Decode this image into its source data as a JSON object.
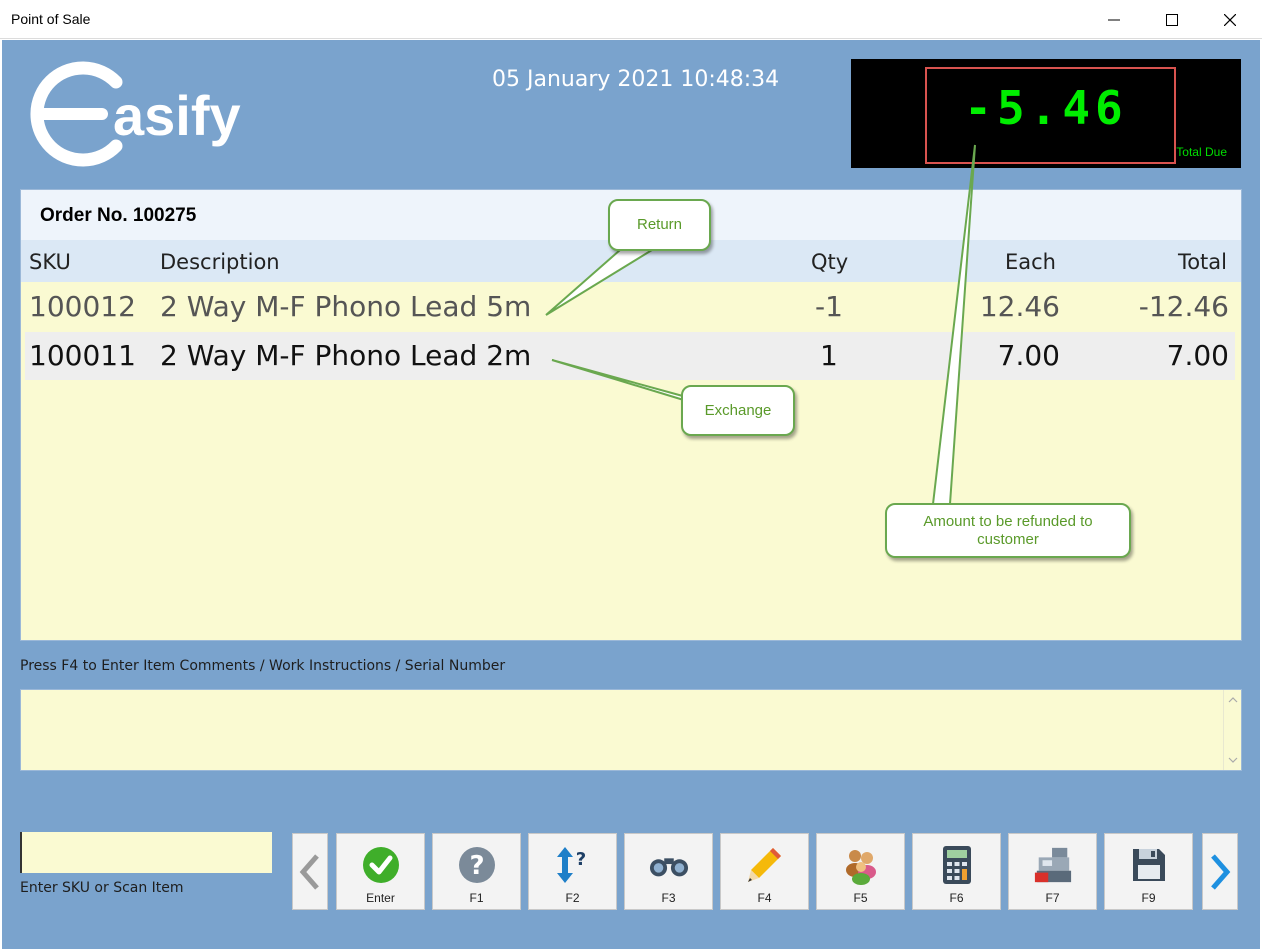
{
  "window": {
    "title": "Point of Sale"
  },
  "header": {
    "logo_text": "asify",
    "datetime": "05 January 2021 10:48:34"
  },
  "display": {
    "amount": "-5.46",
    "label": "Total Due"
  },
  "order": {
    "title": "Order No. 100275",
    "columns": {
      "sku": "SKU",
      "description": "Description",
      "qty": "Qty",
      "each": "Each",
      "total": "Total"
    },
    "rows": [
      {
        "sku": "100012",
        "description": "2 Way M-F Phono Lead 5m",
        "qty": "-1",
        "each": "12.46",
        "total": "-12.46"
      },
      {
        "sku": "100011",
        "description": "2 Way M-F Phono Lead 2m",
        "qty": "1",
        "each": "7.00",
        "total": "7.00"
      }
    ]
  },
  "comments": {
    "label": "Press F4 to Enter Item Comments / Work Instructions / Serial Number",
    "value": ""
  },
  "sku_entry": {
    "label": "Enter SKU or Scan Item",
    "value": ""
  },
  "toolbar": {
    "buttons": [
      {
        "label": "Enter",
        "icon": "check-icon"
      },
      {
        "label": "F1",
        "icon": "help-icon"
      },
      {
        "label": "F2",
        "icon": "sort-query-icon"
      },
      {
        "label": "F3",
        "icon": "binoculars-icon"
      },
      {
        "label": "F4",
        "icon": "pencil-icon"
      },
      {
        "label": "F5",
        "icon": "customers-icon"
      },
      {
        "label": "F6",
        "icon": "calculator-icon"
      },
      {
        "label": "F7",
        "icon": "cash-register-icon"
      },
      {
        "label": "F9",
        "icon": "save-icon"
      }
    ]
  },
  "annotations": {
    "return": "Return",
    "exchange": "Exchange",
    "refund_line1": "Amount to be refunded to",
    "refund_line2": "customer"
  },
  "colors": {
    "background": "#7aa3cd",
    "panel": "#fafad2",
    "display_text": "#00ee00",
    "callout_border": "#6aa84f",
    "highlight": "#d9534f"
  }
}
